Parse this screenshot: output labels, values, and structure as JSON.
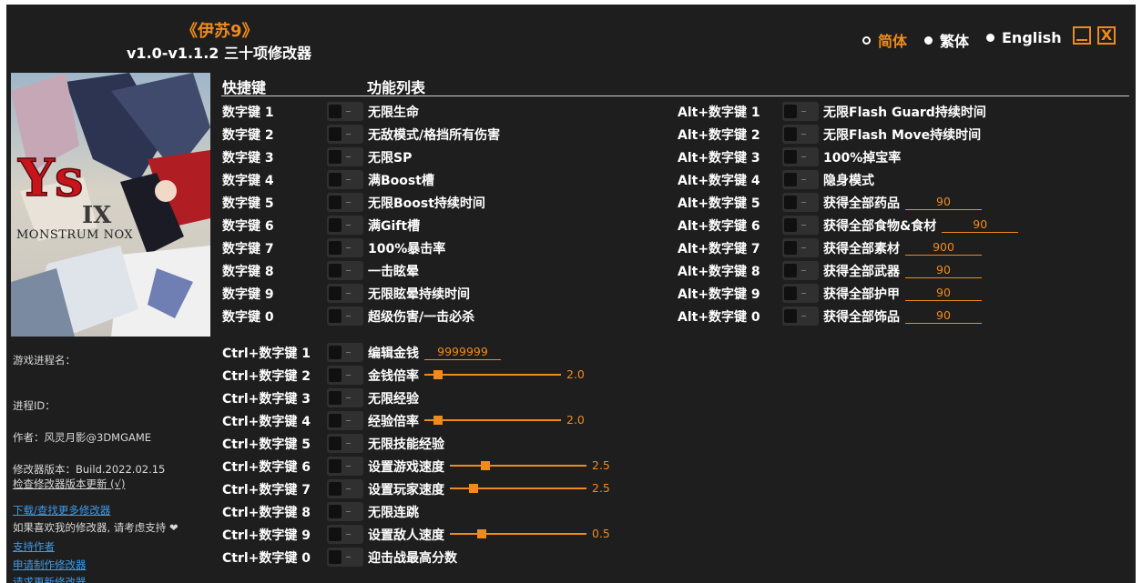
{
  "header": {
    "title": "《伊苏9》",
    "subtitle": "v1.0-v1.1.2 三十项修改器",
    "languages": [
      {
        "label": "简体",
        "active": true
      },
      {
        "label": "繁体",
        "active": false
      },
      {
        "label": "English",
        "active": false
      }
    ],
    "minimize_icon": "minimize-icon",
    "close_icon": "close-icon",
    "close_glyph": "X"
  },
  "sidebar": {
    "cover_logo": "Ys IX MONSTRUM NOX",
    "process_name_label": "游戏进程名：",
    "process_id_label": "进程ID：",
    "author": "作者：风灵月影@3DMGAME",
    "version": "修改器版本：Build.2022.02.15",
    "check_update": "检查修改器版本更新 (√)",
    "download_more": "下载/查找更多修改器",
    "support_text": "如果喜欢我的修改器, 请考虑支持",
    "support_author": "支持作者",
    "request_trainer": "申请制作修改器",
    "request_update": "请求更新修改器"
  },
  "columns": {
    "hotkey": "快捷键",
    "features": "功能列表"
  },
  "colors": {
    "accent": "#f08a1c",
    "background": "#1e1e1e",
    "link": "#3d9be9"
  },
  "left_features": [
    {
      "key": "数字键 1",
      "name": "无限生命"
    },
    {
      "key": "数字键 2",
      "name": "无敌模式/格挡所有伤害"
    },
    {
      "key": "数字键 3",
      "name": "无限SP"
    },
    {
      "key": "数字键 4",
      "name": "满Boost槽"
    },
    {
      "key": "数字键 5",
      "name": "无限Boost持续时间"
    },
    {
      "key": "数字键 6",
      "name": "满Gift槽"
    },
    {
      "key": "数字键 7",
      "name": "100%暴击率"
    },
    {
      "key": "数字键 8",
      "name": "一击眩晕"
    },
    {
      "key": "数字键 9",
      "name": "无限眩晕持续时间"
    },
    {
      "key": "数字键 0",
      "name": "超级伤害/一击必杀"
    }
  ],
  "right_features": [
    {
      "key": "Alt+数字键 1",
      "name": "无限Flash Guard持续时间"
    },
    {
      "key": "Alt+数字键 2",
      "name": "无限Flash Move持续时间"
    },
    {
      "key": "Alt+数字键 3",
      "name": "100%掉宝率"
    },
    {
      "key": "Alt+数字键 4",
      "name": "隐身模式"
    },
    {
      "key": "Alt+数字键 5",
      "name": "获得全部药品",
      "value": "90"
    },
    {
      "key": "Alt+数字键 6",
      "name": "获得全部食物&食材",
      "value": "90"
    },
    {
      "key": "Alt+数字键 7",
      "name": "获得全部素材",
      "value": "900"
    },
    {
      "key": "Alt+数字键 8",
      "name": "获得全部武器",
      "value": "90"
    },
    {
      "key": "Alt+数字键 9",
      "name": "获得全部护甲",
      "value": "90"
    },
    {
      "key": "Alt+数字键 0",
      "name": "获得全部饰品",
      "value": "90"
    }
  ],
  "ctrl_features": [
    {
      "key": "Ctrl+数字键 1",
      "name": "编辑金钱",
      "value": "9999999"
    },
    {
      "key": "Ctrl+数字键 2",
      "name": "金钱倍率",
      "slider": "2.0",
      "fraction": 0.1
    },
    {
      "key": "Ctrl+数字键 3",
      "name": "无限经验"
    },
    {
      "key": "Ctrl+数字键 4",
      "name": "经验倍率",
      "slider": "2.0",
      "fraction": 0.1
    },
    {
      "key": "Ctrl+数字键 5",
      "name": "无限技能经验"
    },
    {
      "key": "Ctrl+数字键 6",
      "name": "设置游戏速度",
      "slider": "2.5",
      "fraction": 0.26
    },
    {
      "key": "Ctrl+数字键 7",
      "name": "设置玩家速度",
      "slider": "2.5",
      "fraction": 0.17
    },
    {
      "key": "Ctrl+数字键 8",
      "name": "无限连跳"
    },
    {
      "key": "Ctrl+数字键 9",
      "name": "设置敌人速度",
      "slider": "0.5",
      "fraction": 0.23
    },
    {
      "key": "Ctrl+数字键 0",
      "name": "迎击战最高分数"
    }
  ]
}
